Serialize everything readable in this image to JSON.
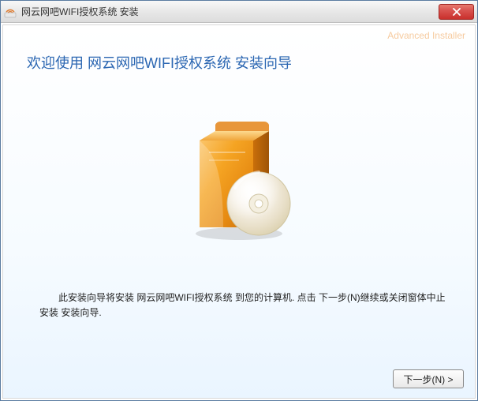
{
  "titlebar": {
    "title": "网云网吧WIFI授权系统 安装"
  },
  "watermark": "Advanced Installer",
  "header": {
    "text": "欢迎使用 网云网吧WIFI授权系统 安装向导"
  },
  "body": {
    "text": "此安装向导将安装 网云网吧WIFI授权系统 到您的计算机. 点击 下一步(N)继续或关闭窗体中止安装 安装向导."
  },
  "footer": {
    "next_label": "下一步(N) >"
  },
  "colors": {
    "accent": "#2b66b2",
    "box_orange_light": "#f8b74e",
    "box_orange_dark": "#d87a15"
  }
}
